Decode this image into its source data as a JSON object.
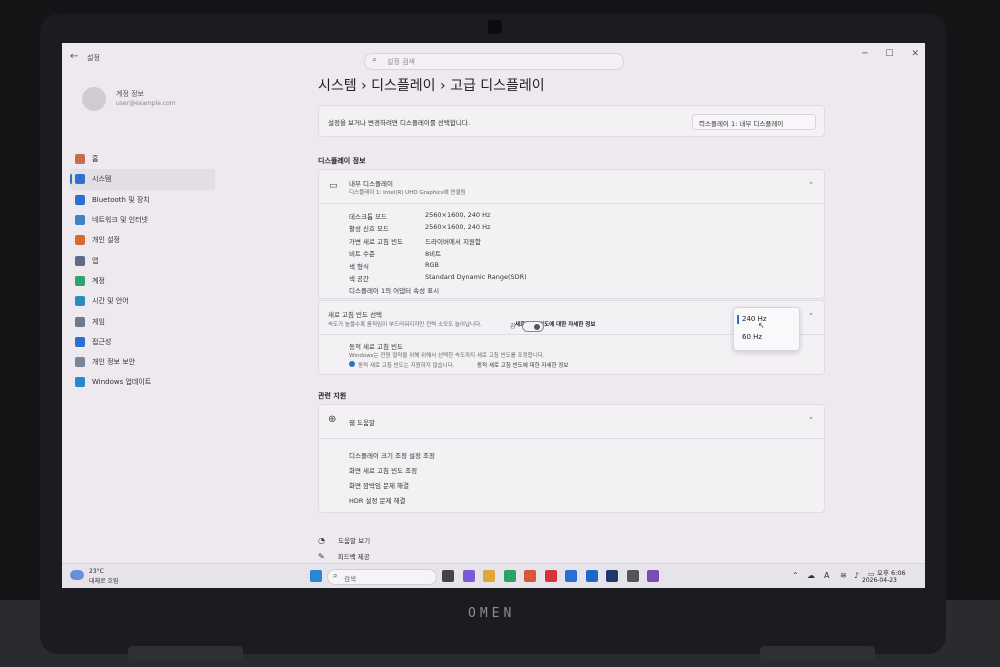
{
  "device": {
    "brand": "OMEN"
  },
  "window": {
    "app_title": "설정",
    "search_placeholder": "설정 검색",
    "back_icon": "back-arrow-icon",
    "controls": [
      "─",
      "☐",
      "✕"
    ]
  },
  "profile": {
    "name": "계정 정보",
    "email": "user@example.com"
  },
  "sidebar": {
    "items": [
      {
        "label": "홈",
        "icon": "home-icon",
        "color": "#c86b4a",
        "selected": false
      },
      {
        "label": "시스템",
        "icon": "monitor-icon",
        "color": "#2a6fd1",
        "selected": true
      },
      {
        "label": "Bluetooth 및 장치",
        "icon": "bluetooth-icon",
        "color": "#2a6fd1",
        "selected": false
      },
      {
        "label": "네트워크 및 인터넷",
        "icon": "wifi-icon",
        "color": "#3a86c9",
        "selected": false
      },
      {
        "label": "개인 설정",
        "icon": "brush-icon",
        "color": "#d46a2c",
        "selected": false
      },
      {
        "label": "앱",
        "icon": "apps-icon",
        "color": "#5f6b86",
        "selected": false
      },
      {
        "label": "계정",
        "icon": "account-icon",
        "color": "#2fa36b",
        "selected": false
      },
      {
        "label": "시간 및 언어",
        "icon": "globe-clock-icon",
        "color": "#2a8fb8",
        "selected": false
      },
      {
        "label": "게임",
        "icon": "gamepad-icon",
        "color": "#6f7a88",
        "selected": false
      },
      {
        "label": "접근성",
        "icon": "accessibility-icon",
        "color": "#2a6fd1",
        "selected": false
      },
      {
        "label": "개인 정보 보안",
        "icon": "shield-icon",
        "color": "#7b8494",
        "selected": false
      },
      {
        "label": "Windows 업데이트",
        "icon": "update-icon",
        "color": "#2a86d1",
        "selected": false
      }
    ]
  },
  "breadcrumb": {
    "part1": "시스템",
    "part2": "디스플레이",
    "part3": "고급 디스플레이",
    "sep": "›"
  },
  "select_display": {
    "text": "설정을 보거나 변경하려면 디스플레이를 선택합니다.",
    "dropdown_value": "디스플레이 1: 내부 디스플레이"
  },
  "display_info": {
    "section_title": "디스플레이 정보",
    "card_title": "내부 디스플레이",
    "card_subtitle": "디스플레이 1: Intel(R) UHD Graphics에 연결됨",
    "rows": [
      {
        "label": "데스크톱 모드",
        "value": "2560×1600, 240 Hz"
      },
      {
        "label": "활성 신호 모드",
        "value": "2560×1600, 240 Hz"
      },
      {
        "label": "가변 새로 고침 빈도",
        "value": "드라이버에서 지원함"
      },
      {
        "label": "비트 수준",
        "value": "8비트"
      },
      {
        "label": "색 형식",
        "value": "RGB"
      },
      {
        "label": "색 공간",
        "value": "Standard Dynamic Range(SDR)"
      }
    ],
    "adapter_link": "디스플레이 1의 어댑터 속성 표시"
  },
  "refresh_rate": {
    "title": "새로 고침 빈도 선택",
    "desc": "속도가 높을수록 움직임이 부드러워지지만 전력 소모도 늘어납니다.",
    "link": "새로 고침 빈도에 대한 자세한 정보",
    "options": [
      "240 Hz",
      "60 Hz"
    ],
    "selected": "240 Hz",
    "dynamic_title": "동적 새로 고침 빈도",
    "dynamic_desc": "Windows는 전원 절약을 위해 위해서 선택한 속도까지 새로 고침 빈도를 조정합니다.",
    "dynamic_note": "동적 새로 고침 빈도는 지원하지 않습니다.",
    "dynamic_note_link": "동적 새로 고침 빈도에 대한 자세한 정보",
    "toggle_state": "off"
  },
  "related": {
    "section_title": "관련 지원",
    "card_title": "웹 도움말",
    "links": [
      "디스플레이 크기 조정 설정 조정",
      "화면 새로 고침 빈도 조정",
      "화면 깜박임 문제 해결",
      "HDR 설정 문제 해결"
    ]
  },
  "footer": {
    "help": "도움말 보기",
    "feedback": "피드백 제공"
  },
  "taskbar": {
    "weather_temp": "23°C",
    "weather_desc": "대체로 흐림",
    "search_placeholder": "검색",
    "icons": [
      {
        "name": "start-icon",
        "color": "#2a86d1"
      },
      {
        "name": "widgets-icon",
        "color": "#444444"
      },
      {
        "name": "copilot-icon",
        "color": "#7a5ad6"
      },
      {
        "name": "file-explorer-icon",
        "color": "#e0a63a"
      },
      {
        "name": "edge-icon",
        "color": "#2aa36b"
      },
      {
        "name": "store-icon",
        "color": "#d65a3a"
      },
      {
        "name": "app-red-icon",
        "color": "#d6333a"
      },
      {
        "name": "mail-icon",
        "color": "#2a6fd1"
      },
      {
        "name": "outlook-icon",
        "color": "#1f66c9"
      },
      {
        "name": "steam-icon",
        "color": "#1b3b66"
      },
      {
        "name": "settings-icon",
        "color": "#555555"
      },
      {
        "name": "security-icon",
        "color": "#7a4ab8"
      }
    ],
    "time": "오후 6:06",
    "date": "2026-04-23"
  }
}
